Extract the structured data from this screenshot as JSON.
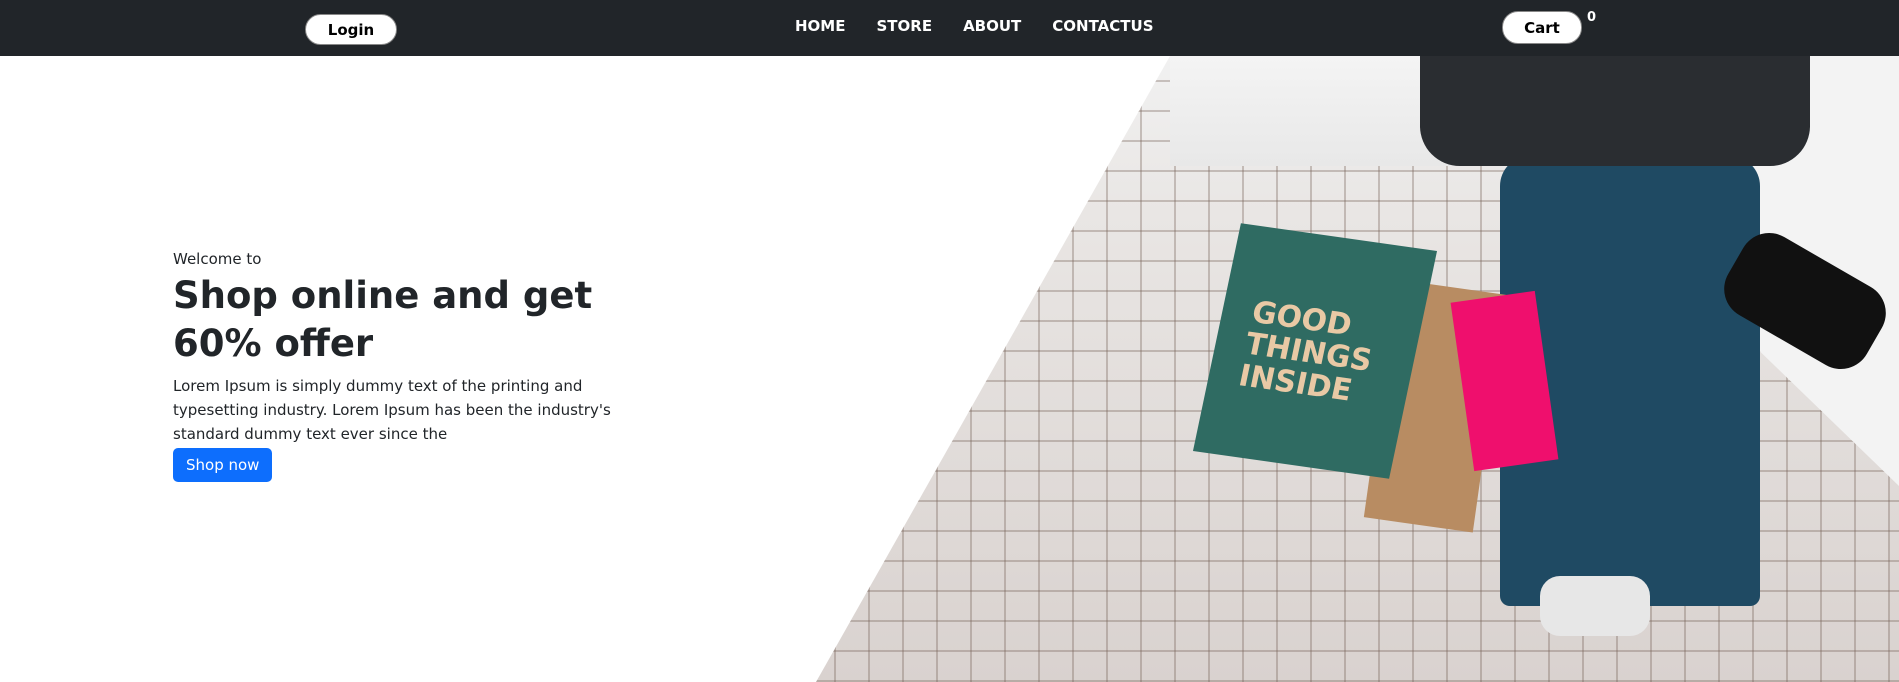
{
  "nav": {
    "login": "Login",
    "links": [
      "HOME",
      "STORE",
      "ABOUT",
      "CONTACTUS"
    ],
    "cart": "Cart",
    "cart_count": "0"
  },
  "hero": {
    "welcome": "Welcome to",
    "title": "Shop online and get 60% offer",
    "description": "Lorem Ipsum is simply dummy text of the printing and typesetting industry. Lorem Ipsum has been the industry's standard dummy text ever since the",
    "button": "Shop now"
  },
  "image": {
    "bag_text": "GOOD THINGS INSIDE"
  },
  "colors": {
    "navbar": "#212529",
    "primary": "#0d6efd"
  }
}
